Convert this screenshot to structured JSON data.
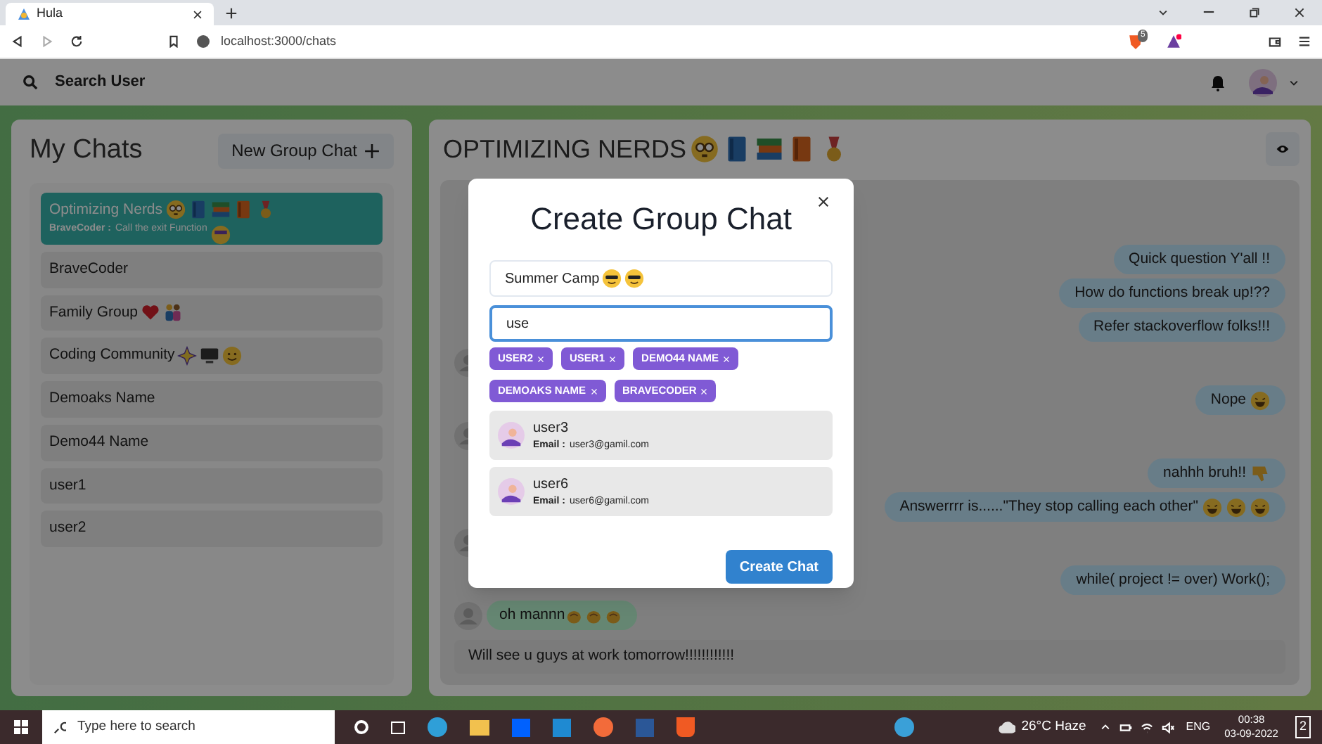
{
  "browser": {
    "tab_title": "Hula",
    "url": "localhost:3000/chats",
    "shield_badge": "5"
  },
  "header": {
    "search_label": "Search User"
  },
  "sidebar": {
    "title": "My Chats",
    "new_group_button": "New Group Chat",
    "chats": [
      {
        "name": "Optimizing Nerds",
        "latest_sender": "BraveCoder :",
        "latest_message": "Call the exit Function",
        "selected": true
      },
      {
        "name": "BraveCoder",
        "selected": false
      },
      {
        "name": "Family Group",
        "selected": false
      },
      {
        "name": "Coding Community",
        "selected": false
      },
      {
        "name": "Demoaks Name",
        "selected": false
      },
      {
        "name": "Demo44 Name",
        "selected": false
      },
      {
        "name": "user1",
        "selected": false
      },
      {
        "name": "user2",
        "selected": false
      }
    ]
  },
  "chat": {
    "title": "OPTIMIZING NERDS",
    "messages": [
      {
        "kind": "out",
        "text": "Quick question Y'all !!"
      },
      {
        "kind": "out",
        "text": "How do functions break up!??"
      },
      {
        "kind": "out",
        "text": "Refer stackoverflow folks!!!"
      },
      {
        "kind": "in_hidden"
      },
      {
        "kind": "out",
        "text": "Nope"
      },
      {
        "kind": "in_hidden"
      },
      {
        "kind": "out",
        "text": "nahhh bruh!!"
      },
      {
        "kind": "out",
        "text": "Answerrrr is......\"They stop calling each other\""
      },
      {
        "kind": "in_hidden"
      },
      {
        "kind": "out",
        "text": "while( project != over) Work();"
      },
      {
        "kind": "in",
        "text": "oh mannn"
      }
    ],
    "input_value": "Will see u guys at work tomorrow!!!!!!!!!!!!"
  },
  "modal": {
    "title": "Create Group Chat",
    "name_value": "Summer Camp",
    "search_value": "use",
    "chips": [
      "USER2",
      "USER1",
      "DEMO44 NAME",
      "DEMOAKS NAME",
      "BRAVECODER"
    ],
    "results": [
      {
        "name": "user3",
        "email_label": "Email :",
        "email": "user3@gamil.com"
      },
      {
        "name": "user6",
        "email_label": "Email :",
        "email": "user6@gamil.com"
      }
    ],
    "submit": "Create Chat"
  },
  "taskbar": {
    "search_placeholder": "Type here to search",
    "weather": "26°C Haze",
    "language": "ENG",
    "time": "00:38",
    "date": "03-09-2022",
    "notifications": "2"
  }
}
